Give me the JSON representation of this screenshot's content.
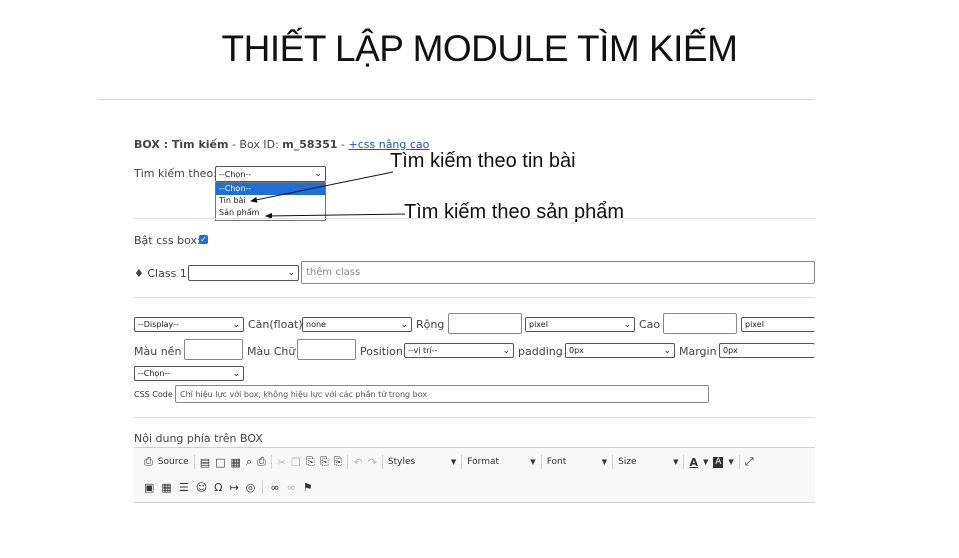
{
  "slide": {
    "title": "THIẾT LẬP MODULE TÌM KIẾM",
    "callout_1": "Tìm kiếm theo tin bài",
    "callout_2": "Tìm kiếm theo sản phẩm"
  },
  "box": {
    "label": "BOX : Tìm kiếm",
    "box_id_label": " - Box ID: ",
    "box_id": "m_58351",
    "dash": " - ",
    "css_link": "+css nâng cao"
  },
  "search_by": {
    "label": "Tìm kiếm theo:",
    "selected": "--Chọn--",
    "options": [
      "--Chọn--",
      "Tin bài",
      "Sản phẩm"
    ]
  },
  "css_box": {
    "label": "Bật css box:",
    "checked": true
  },
  "class_row": {
    "label": "♦ Class 1:",
    "selected": "",
    "placeholder": "thêm class"
  },
  "style_row1": {
    "display": "--Display--",
    "float_label": "Căn(float)",
    "float_value": "none",
    "width_label": "Rộng",
    "width_unit": "pixel",
    "height_label": "Cao",
    "height_unit": "pixel"
  },
  "style_row2": {
    "bg_label": "Màu nền",
    "color_label": "Màu Chữ",
    "position_label": "Position",
    "position_value": "--vị trí--",
    "padding_label": "padding",
    "padding_value": "0px",
    "margin_label": "Margin",
    "margin_value": "0px"
  },
  "choose_row": {
    "selected": "--Chọn--"
  },
  "css_code": {
    "label": "CSS Code",
    "placeholder": "Chỉ hiệu lực với box, không hiệu lực với các phần tử trong box"
  },
  "content": {
    "label": "Nội dung phía trên BOX"
  },
  "editor_toolbar": {
    "source": "Source",
    "styles": "Styles",
    "format": "Format",
    "font": "Font",
    "size": "Size"
  }
}
